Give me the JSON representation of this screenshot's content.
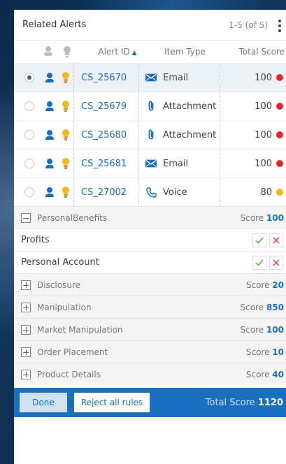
{
  "header": {
    "title": "Related Alerts",
    "count": "1-5 (of 5)"
  },
  "columns": {
    "alert_id": "Alert ID",
    "item_type": "Item Type",
    "total_score": "Total Score"
  },
  "alerts": [
    {
      "id": "CS_25670",
      "type": "Email",
      "type_icon": "envelope-icon",
      "score": "100",
      "status_color": "#e5262d",
      "selected": true
    },
    {
      "id": "CS_25679",
      "type": "Attachment",
      "type_icon": "paperclip-icon",
      "score": "100",
      "status_color": "#e5262d",
      "selected": false
    },
    {
      "id": "CS_25680",
      "type": "Attachment",
      "type_icon": "paperclip-icon",
      "score": "100",
      "status_color": "#e5262d",
      "selected": false
    },
    {
      "id": "CS_25681",
      "type": "Email",
      "type_icon": "envelope-icon",
      "score": "100",
      "status_color": "#e5262d",
      "selected": false
    },
    {
      "id": "CS_27002",
      "type": "Voice",
      "type_icon": "phone-icon",
      "score": "80",
      "status_color": "#f3b71d",
      "selected": false
    }
  ],
  "groups": [
    {
      "name": "PersonalBenefits",
      "score_label": "Score",
      "score": "100",
      "expanded": true,
      "rules": [
        {
          "name": "Profits"
        },
        {
          "name": "Personal Account"
        }
      ]
    },
    {
      "name": "Disclosure",
      "score_label": "Score",
      "score": "20",
      "expanded": false
    },
    {
      "name": "Manipulation",
      "score_label": "Score",
      "score": "850",
      "expanded": false
    },
    {
      "name": "Market Manipulation",
      "score_label": "Score",
      "score": "100",
      "expanded": false
    },
    {
      "name": "Order Placement",
      "score_label": "Score",
      "score": "10",
      "expanded": false
    },
    {
      "name": "Product Details",
      "score_label": "Score",
      "score": "40",
      "expanded": false
    }
  ],
  "footer": {
    "done_label": "Done",
    "reject_label": "Reject all rules",
    "total_label": "Total Score",
    "total_value": "1120"
  },
  "colors": {
    "accent": "#1a6fc1",
    "high": "#e5262d",
    "medium": "#f3b71d",
    "accept": "#4caf50",
    "reject": "#e53935"
  }
}
